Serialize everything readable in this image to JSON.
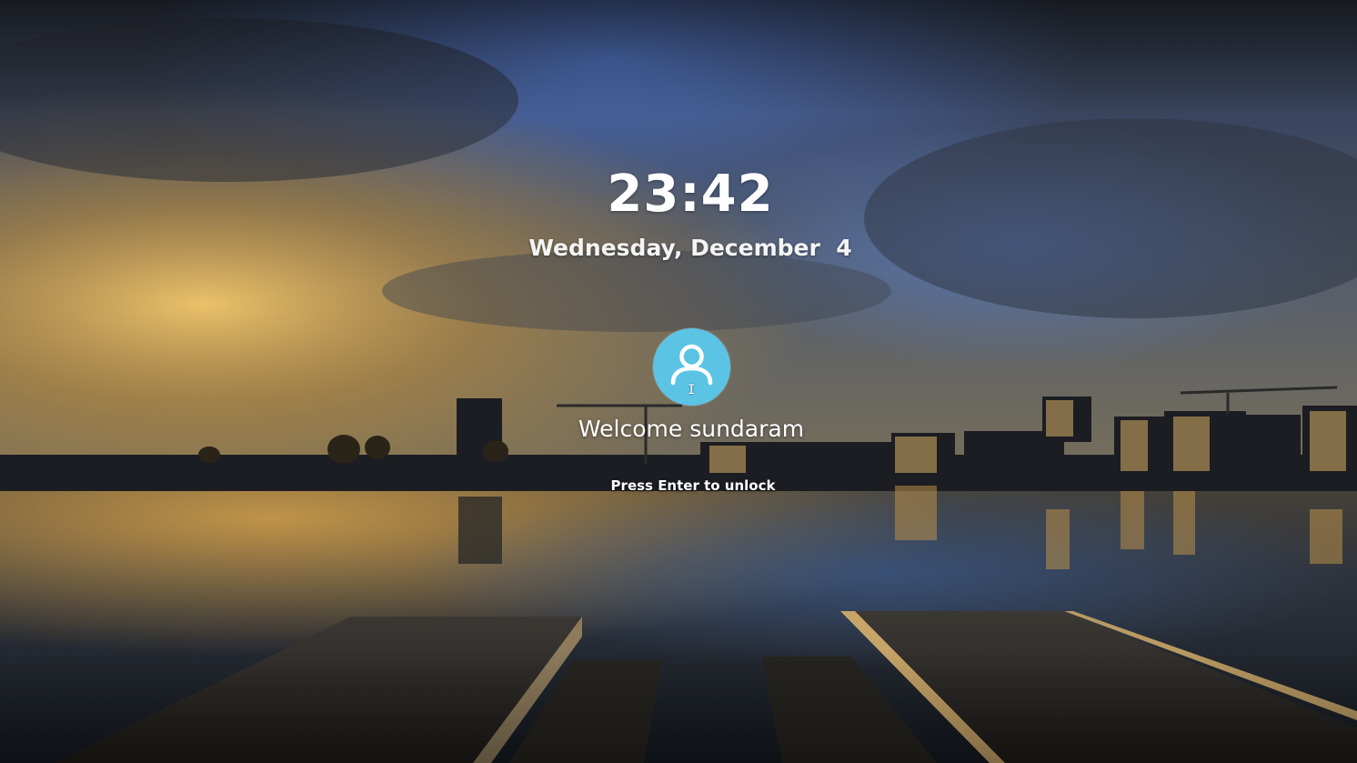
{
  "lock_screen": {
    "time": "23:42",
    "date": "Wednesday, December  4",
    "user": {
      "avatar_icon": "user-icon",
      "avatar_color": "#5bc4e4",
      "welcome_text": "Welcome sundaram"
    },
    "unlock_hint": "Press Enter to unlock"
  },
  "wallpaper": {
    "subject": "lakeside jetty at sunset with city skyline",
    "sky_colors": [
      "#4a5f8e",
      "#2e3a52",
      "#c99a3f"
    ],
    "water_color": "#2a3340"
  }
}
